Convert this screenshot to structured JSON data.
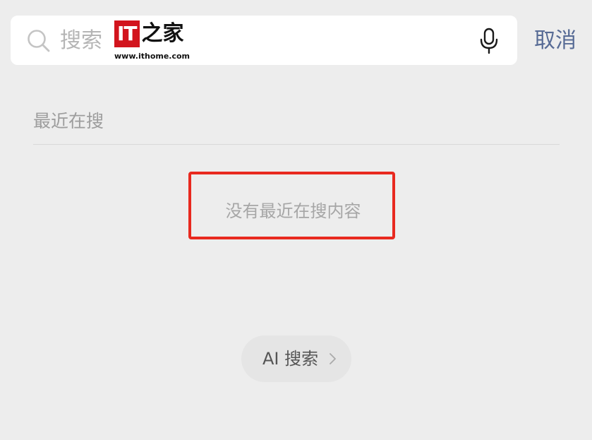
{
  "search": {
    "placeholder": "搜索",
    "value": ""
  },
  "watermark": {
    "logo_text": "IT之家",
    "url": "www.ithome.com"
  },
  "header": {
    "cancel_label": "取消"
  },
  "recent": {
    "title": "最近在搜",
    "empty_text": "没有最近在搜内容"
  },
  "ai_search": {
    "label": "AI 搜索"
  },
  "colors": {
    "background": "#ededed",
    "accent_link": "#576b95",
    "highlight_border": "#e8291f",
    "brand_red": "#d2141d"
  }
}
